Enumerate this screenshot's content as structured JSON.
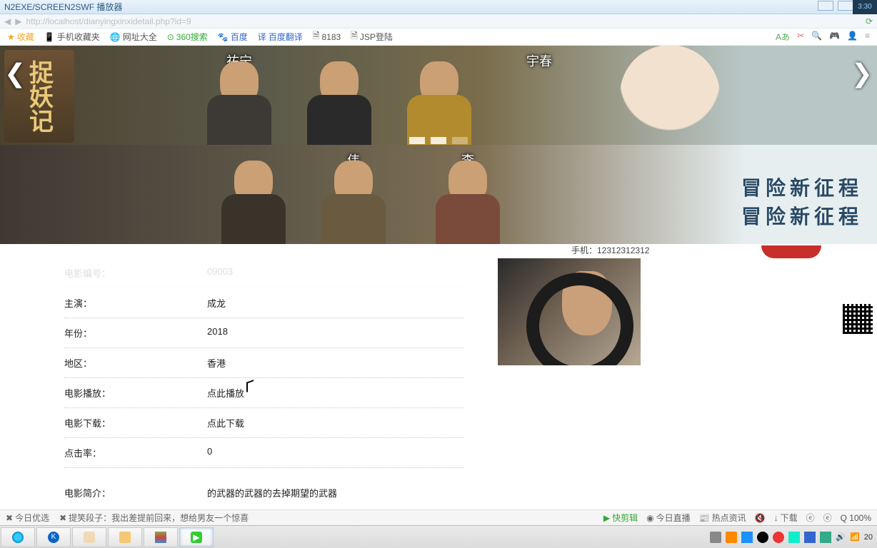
{
  "window": {
    "title": "N2EXE/SCREEN2SWF 播放器",
    "url": "http://localhost/dianyingxinxidetail.php?id=9"
  },
  "bookmarks": {
    "fav": "收藏",
    "items": [
      "手机收藏夹",
      "网址大全",
      "360搜索",
      "百度",
      "百度翻译",
      "8183",
      "JSP登陆"
    ]
  },
  "banner": {
    "names_top": [
      "祐宁",
      "",
      "",
      "宇春"
    ],
    "names_bot": [
      "",
      "伟",
      "李"
    ],
    "adv_line1": "冒险新征程",
    "adv_line2": "冒险新征程",
    "poster_title": "捉妖记"
  },
  "phone": "手机：12312312312",
  "details": [
    {
      "label": "电影编号：",
      "value": "09003"
    },
    {
      "label": "主演：",
      "value": "成龙"
    },
    {
      "label": "年份：",
      "value": "2018"
    },
    {
      "label": "地区：",
      "value": "香港"
    },
    {
      "label": "电影播放：",
      "value": "点此播放",
      "link": true
    },
    {
      "label": "电影下载：",
      "value": "点此下载",
      "link": true
    },
    {
      "label": "点击率：",
      "value": "0"
    },
    {
      "label": "电影简介：",
      "value": "的武器的武器的去掉期望的武器",
      "last": true
    }
  ],
  "statusbar": {
    "left1": "今日优选",
    "left2": "提笑段子：我出差提前回来，想给男友一个惊喜",
    "right": [
      "快剪辑",
      "今日直播",
      "热点资讯",
      "↓",
      "下载",
      "ⓔ",
      "ⓔ"
    ],
    "zoom": "Q 100%"
  },
  "taskbar": {
    "apps": [
      "browser",
      "kugou",
      "conan",
      "explorer",
      "winrar",
      "screen2swf"
    ],
    "clock": "20",
    "time_overlay": "3:30"
  }
}
